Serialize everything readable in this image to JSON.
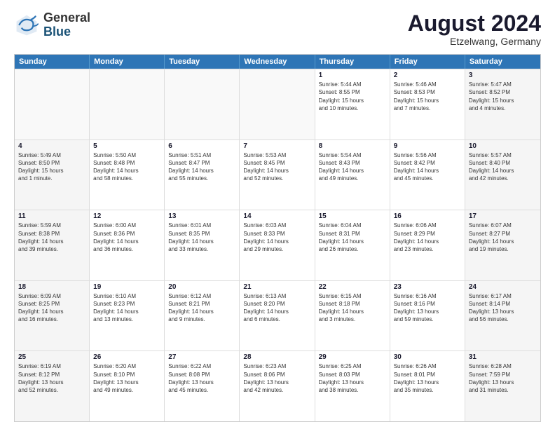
{
  "header": {
    "logo_general": "General",
    "logo_blue": "Blue",
    "month_year": "August 2024",
    "location": "Etzelwang, Germany"
  },
  "weekdays": [
    "Sunday",
    "Monday",
    "Tuesday",
    "Wednesday",
    "Thursday",
    "Friday",
    "Saturday"
  ],
  "rows": [
    [
      {
        "day": "",
        "empty": true
      },
      {
        "day": "",
        "empty": true
      },
      {
        "day": "",
        "empty": true
      },
      {
        "day": "",
        "empty": true
      },
      {
        "day": "1",
        "lines": [
          "Sunrise: 5:44 AM",
          "Sunset: 8:55 PM",
          "Daylight: 15 hours",
          "and 10 minutes."
        ]
      },
      {
        "day": "2",
        "lines": [
          "Sunrise: 5:46 AM",
          "Sunset: 8:53 PM",
          "Daylight: 15 hours",
          "and 7 minutes."
        ]
      },
      {
        "day": "3",
        "lines": [
          "Sunrise: 5:47 AM",
          "Sunset: 8:52 PM",
          "Daylight: 15 hours",
          "and 4 minutes."
        ],
        "shaded": true
      }
    ],
    [
      {
        "day": "4",
        "lines": [
          "Sunrise: 5:49 AM",
          "Sunset: 8:50 PM",
          "Daylight: 15 hours",
          "and 1 minute."
        ],
        "shaded": true
      },
      {
        "day": "5",
        "lines": [
          "Sunrise: 5:50 AM",
          "Sunset: 8:48 PM",
          "Daylight: 14 hours",
          "and 58 minutes."
        ]
      },
      {
        "day": "6",
        "lines": [
          "Sunrise: 5:51 AM",
          "Sunset: 8:47 PM",
          "Daylight: 14 hours",
          "and 55 minutes."
        ]
      },
      {
        "day": "7",
        "lines": [
          "Sunrise: 5:53 AM",
          "Sunset: 8:45 PM",
          "Daylight: 14 hours",
          "and 52 minutes."
        ]
      },
      {
        "day": "8",
        "lines": [
          "Sunrise: 5:54 AM",
          "Sunset: 8:43 PM",
          "Daylight: 14 hours",
          "and 49 minutes."
        ]
      },
      {
        "day": "9",
        "lines": [
          "Sunrise: 5:56 AM",
          "Sunset: 8:42 PM",
          "Daylight: 14 hours",
          "and 45 minutes."
        ]
      },
      {
        "day": "10",
        "lines": [
          "Sunrise: 5:57 AM",
          "Sunset: 8:40 PM",
          "Daylight: 14 hours",
          "and 42 minutes."
        ],
        "shaded": true
      }
    ],
    [
      {
        "day": "11",
        "lines": [
          "Sunrise: 5:59 AM",
          "Sunset: 8:38 PM",
          "Daylight: 14 hours",
          "and 39 minutes."
        ],
        "shaded": true
      },
      {
        "day": "12",
        "lines": [
          "Sunrise: 6:00 AM",
          "Sunset: 8:36 PM",
          "Daylight: 14 hours",
          "and 36 minutes."
        ]
      },
      {
        "day": "13",
        "lines": [
          "Sunrise: 6:01 AM",
          "Sunset: 8:35 PM",
          "Daylight: 14 hours",
          "and 33 minutes."
        ]
      },
      {
        "day": "14",
        "lines": [
          "Sunrise: 6:03 AM",
          "Sunset: 8:33 PM",
          "Daylight: 14 hours",
          "and 29 minutes."
        ]
      },
      {
        "day": "15",
        "lines": [
          "Sunrise: 6:04 AM",
          "Sunset: 8:31 PM",
          "Daylight: 14 hours",
          "and 26 minutes."
        ]
      },
      {
        "day": "16",
        "lines": [
          "Sunrise: 6:06 AM",
          "Sunset: 8:29 PM",
          "Daylight: 14 hours",
          "and 23 minutes."
        ]
      },
      {
        "day": "17",
        "lines": [
          "Sunrise: 6:07 AM",
          "Sunset: 8:27 PM",
          "Daylight: 14 hours",
          "and 19 minutes."
        ],
        "shaded": true
      }
    ],
    [
      {
        "day": "18",
        "lines": [
          "Sunrise: 6:09 AM",
          "Sunset: 8:25 PM",
          "Daylight: 14 hours",
          "and 16 minutes."
        ],
        "shaded": true
      },
      {
        "day": "19",
        "lines": [
          "Sunrise: 6:10 AM",
          "Sunset: 8:23 PM",
          "Daylight: 14 hours",
          "and 13 minutes."
        ]
      },
      {
        "day": "20",
        "lines": [
          "Sunrise: 6:12 AM",
          "Sunset: 8:21 PM",
          "Daylight: 14 hours",
          "and 9 minutes."
        ]
      },
      {
        "day": "21",
        "lines": [
          "Sunrise: 6:13 AM",
          "Sunset: 8:20 PM",
          "Daylight: 14 hours",
          "and 6 minutes."
        ]
      },
      {
        "day": "22",
        "lines": [
          "Sunrise: 6:15 AM",
          "Sunset: 8:18 PM",
          "Daylight: 14 hours",
          "and 3 minutes."
        ]
      },
      {
        "day": "23",
        "lines": [
          "Sunrise: 6:16 AM",
          "Sunset: 8:16 PM",
          "Daylight: 13 hours",
          "and 59 minutes."
        ]
      },
      {
        "day": "24",
        "lines": [
          "Sunrise: 6:17 AM",
          "Sunset: 8:14 PM",
          "Daylight: 13 hours",
          "and 56 minutes."
        ],
        "shaded": true
      }
    ],
    [
      {
        "day": "25",
        "lines": [
          "Sunrise: 6:19 AM",
          "Sunset: 8:12 PM",
          "Daylight: 13 hours",
          "and 52 minutes."
        ],
        "shaded": true
      },
      {
        "day": "26",
        "lines": [
          "Sunrise: 6:20 AM",
          "Sunset: 8:10 PM",
          "Daylight: 13 hours",
          "and 49 minutes."
        ]
      },
      {
        "day": "27",
        "lines": [
          "Sunrise: 6:22 AM",
          "Sunset: 8:08 PM",
          "Daylight: 13 hours",
          "and 45 minutes."
        ]
      },
      {
        "day": "28",
        "lines": [
          "Sunrise: 6:23 AM",
          "Sunset: 8:06 PM",
          "Daylight: 13 hours",
          "and 42 minutes."
        ]
      },
      {
        "day": "29",
        "lines": [
          "Sunrise: 6:25 AM",
          "Sunset: 8:03 PM",
          "Daylight: 13 hours",
          "and 38 minutes."
        ]
      },
      {
        "day": "30",
        "lines": [
          "Sunrise: 6:26 AM",
          "Sunset: 8:01 PM",
          "Daylight: 13 hours",
          "and 35 minutes."
        ]
      },
      {
        "day": "31",
        "lines": [
          "Sunrise: 6:28 AM",
          "Sunset: 7:59 PM",
          "Daylight: 13 hours",
          "and 31 minutes."
        ],
        "shaded": true
      }
    ]
  ]
}
